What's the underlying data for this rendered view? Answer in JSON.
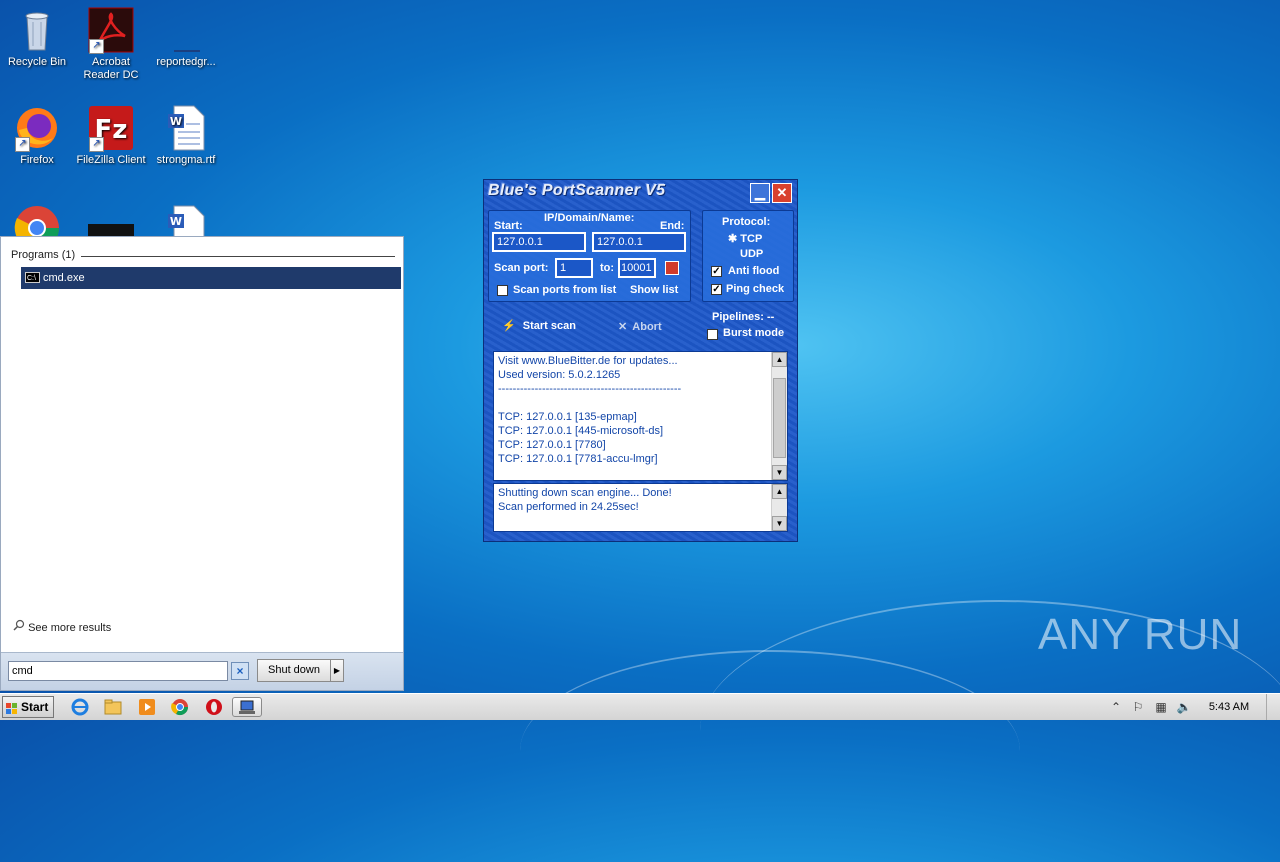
{
  "desktop": {
    "icons": [
      {
        "label": "Recycle Bin"
      },
      {
        "label": "Acrobat Reader DC"
      },
      {
        "label": "reportedgr..."
      },
      {
        "label": "Firefox"
      },
      {
        "label": "FileZilla Client"
      },
      {
        "label": "strongma.rtf"
      }
    ]
  },
  "start_menu": {
    "section_header": "Programs (1)",
    "result_item": "cmd.exe",
    "cmd_icon_text": "C:\\",
    "see_more": "See more results",
    "search_value": "cmd",
    "shutdown_label": "Shut down"
  },
  "taskbar": {
    "start_label": "Start",
    "clock": "5:43 AM"
  },
  "portscanner": {
    "title": "Blue's PortScanner V5",
    "ip_header": "IP/Domain/Name:",
    "start_label": "Start:",
    "end_label": "End:",
    "start_ip": "127.0.0.1",
    "end_ip": "127.0.0.1",
    "scan_port_label": "Scan port:",
    "port_from": "1",
    "to_label": "to:",
    "port_to": "10001",
    "scan_from_list_label": "Scan ports from list",
    "show_list_label": "Show list",
    "protocol_label": "Protocol:",
    "tcp_label": "TCP",
    "udp_label": "UDP",
    "anti_flood_label": "Anti flood",
    "ping_check_label": "Ping check",
    "start_scan_label": "Start scan",
    "abort_label": "Abort",
    "pipelines_label": "Pipelines: --",
    "burst_mode_label": "Burst mode",
    "log_lines": [
      "Visit www.BlueBitter.de for updates...",
      "Used version: 5.0.2.1265",
      "--------------------------------------------------",
      "",
      "TCP: 127.0.0.1 [135-epmap]",
      "TCP: 127.0.0.1 [445-microsoft-ds]",
      "TCP: 127.0.0.1 [7780]",
      "TCP: 127.0.0.1 [7781-accu-lmgr]"
    ],
    "status_lines": [
      "Shutting down scan engine... Done!",
      "Scan performed in 24.25sec!"
    ]
  },
  "watermark": "ANY RUN",
  "colors": {
    "window_blue": "#1d57c9",
    "selection": "#1f3a6b",
    "log_text": "#1346a8"
  }
}
